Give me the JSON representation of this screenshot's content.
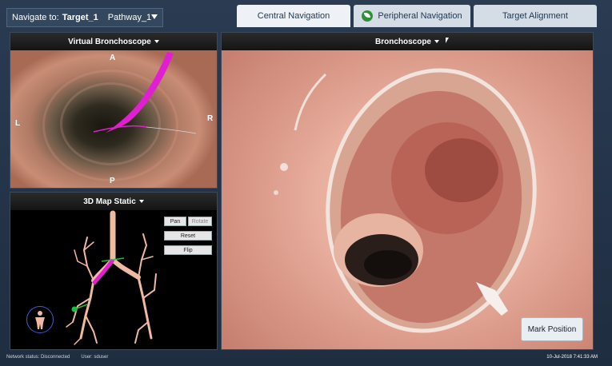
{
  "topbar": {
    "navigate_prefix": "Navigate to:",
    "target": "Target_1",
    "pathway": "Pathway_1",
    "tabs": [
      {
        "label": "Central Navigation",
        "active": true
      },
      {
        "label": "Peripheral Navigation",
        "icon": "leaf-icon"
      },
      {
        "label": "Target Alignment"
      }
    ]
  },
  "virtual_bronchoscope": {
    "title": "Virtual Bronchoscope",
    "orientation": {
      "top": "A",
      "bottom": "P",
      "left": "L",
      "right": "R"
    }
  },
  "map": {
    "title": "3D Map Static",
    "buttons": {
      "pan": "Pan",
      "rotate": "Rotate",
      "reset": "Reset",
      "flip": "Flip"
    }
  },
  "bronchoscope": {
    "title": "Bronchoscope",
    "mark_position": "Mark Position"
  },
  "status": {
    "network": "Network status: Disconnected",
    "user": "User: sduser",
    "timestamp": "10-Jul-2018 7:41:33 AM"
  },
  "colors": {
    "path": "#e020d0",
    "airway": "#f0b9a2",
    "marker": "#19c23a"
  }
}
